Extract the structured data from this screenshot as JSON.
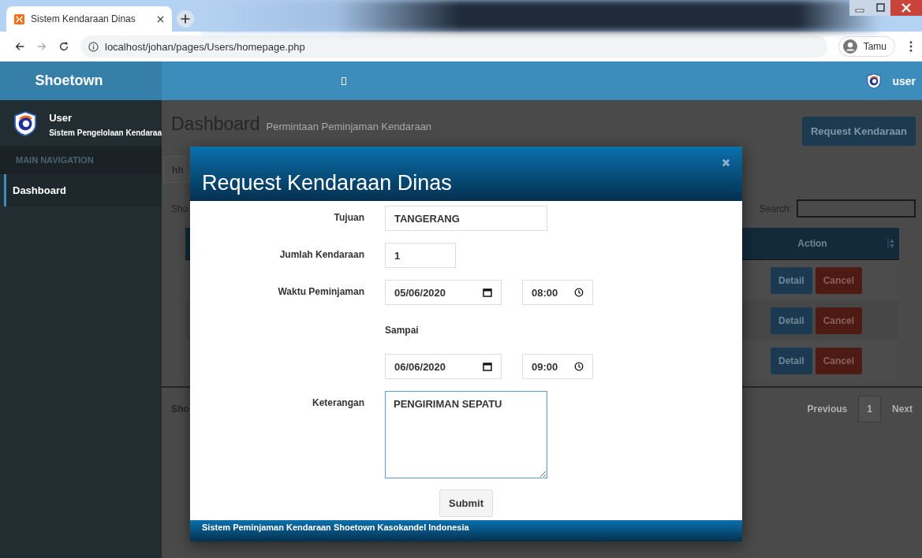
{
  "browser": {
    "tab_title": "Sistem Kendaraan Dinas",
    "url": "localhost/johan/pages/Users/homepage.php",
    "profile_label": "Tamu"
  },
  "header": {
    "brand": "Shoetown",
    "user_name": "user"
  },
  "sidebar": {
    "user_name": "User",
    "subtitle": "Sistem Pengelolaan Kendaraa",
    "nav_header": "MAIN NAVIGATION",
    "items": [
      {
        "label": "Dashboard",
        "selected": true
      }
    ]
  },
  "content": {
    "title": "Dashboard",
    "subtitle": "Permintaan Peminjaman Kendaraan",
    "request_button": "Request Kendaraan",
    "length_partial": "hh",
    "show_partial": "Sho",
    "search_label": "Search:",
    "table": {
      "action_header": "Action",
      "rows": [
        {
          "actions": [
            "Detail",
            "Cancel"
          ]
        },
        {
          "actions": [
            "Detail",
            "Cancel"
          ]
        },
        {
          "actions": [
            "Detail",
            "Cancel"
          ]
        }
      ]
    },
    "info_partial": "Sho",
    "pagination": {
      "previous": "Previous",
      "pages": [
        "1"
      ],
      "next": "Next"
    }
  },
  "modal": {
    "title": "Request Kendaraan Dinas",
    "fields": [
      {
        "kind": "text",
        "label": "Tujuan",
        "value": "TANGERANG"
      },
      {
        "kind": "number",
        "label": "Jumlah Kendaraan",
        "value": "1"
      },
      {
        "kind": "datetime",
        "label": "Waktu Peminjaman",
        "date": "05/06/2020",
        "time": "08:00"
      },
      {
        "kind": "caption",
        "label": "Sampai"
      },
      {
        "kind": "datetime",
        "date": "06/06/2020",
        "time": "09:00"
      },
      {
        "kind": "textarea",
        "label": "Keterangan",
        "value": "PENGIRIMAN SEPATU"
      }
    ],
    "submit": "Submit",
    "footer": "Sistem Peminjaman Kendaraan Shoetown Kasokandel Indonesia"
  }
}
